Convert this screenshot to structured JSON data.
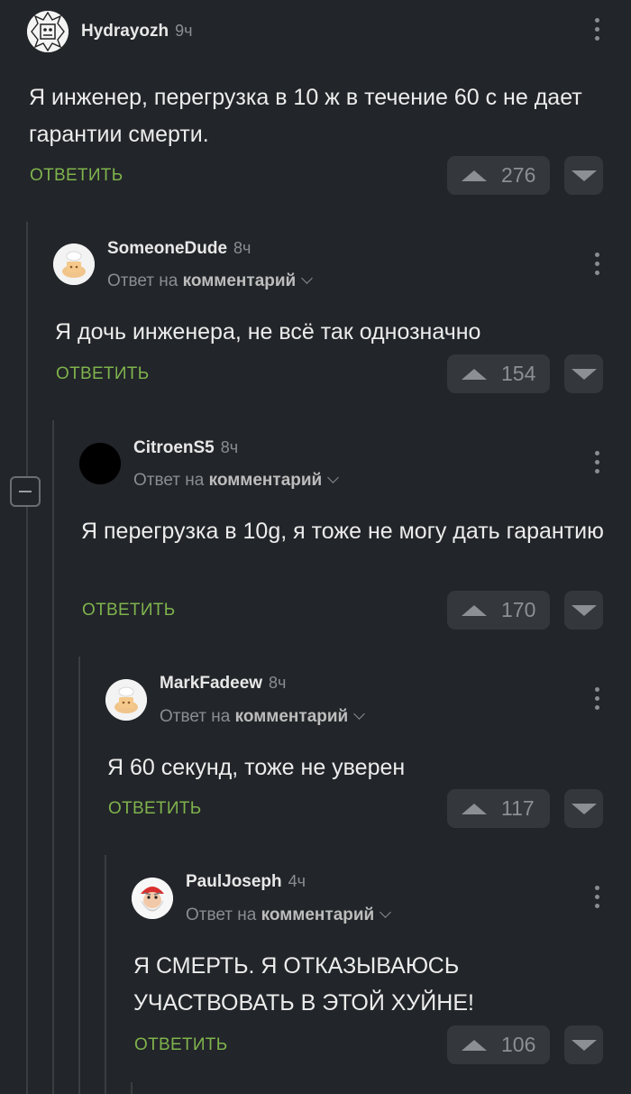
{
  "comments": [
    {
      "username": "Hydrayozh",
      "time": "9ч",
      "reply_prefix": "",
      "reply_link": "",
      "text": "Я инженер, перегрузка в 10 ж в течение 60 с не дает гарантии смерти.",
      "reply_label": "ОТВЕТИТЬ",
      "votes": "276",
      "avatar_icon": "sketch-face-avatar"
    },
    {
      "username": "SomeoneDude",
      "time": "8ч",
      "reply_prefix": "Ответ на",
      "reply_link": "комментарий",
      "text": "Я дочь инженера, не всё так однозначно",
      "reply_label": "ОТВЕТИТЬ",
      "votes": "154",
      "avatar_icon": "default-pikabu-avatar"
    },
    {
      "username": "CitroenS5",
      "time": "8ч",
      "reply_prefix": "Ответ на",
      "reply_link": "комментарий",
      "text": "Я перегрузка в 10g, я тоже не могу дать гарантию",
      "reply_label": "ОТВЕТИТЬ",
      "votes": "170",
      "avatar_icon": "black-circle-avatar"
    },
    {
      "username": "MarkFadeew",
      "time": "8ч",
      "reply_prefix": "Ответ на",
      "reply_link": "комментарий",
      "text": "Я 60 секунд, тоже не уверен",
      "reply_label": "ОТВЕТИТЬ",
      "votes": "117",
      "avatar_icon": "default-pikabu-avatar"
    },
    {
      "username": "PaulJoseph",
      "time": "4ч",
      "reply_prefix": "Ответ на",
      "reply_link": "комментарий",
      "text": "Я СМЕРТЬ. Я ОТКАЗЫВАЮСЬ УЧАСТВОВАТЬ В ЭТОЙ ХУЙНЕ!",
      "reply_label": "ОТВЕТИТЬ",
      "votes": "106",
      "avatar_icon": "old-man-cartoon-avatar"
    }
  ],
  "colors": {
    "background": "#222529",
    "reply_green": "#7fb34d",
    "button_bg": "#34383d"
  }
}
